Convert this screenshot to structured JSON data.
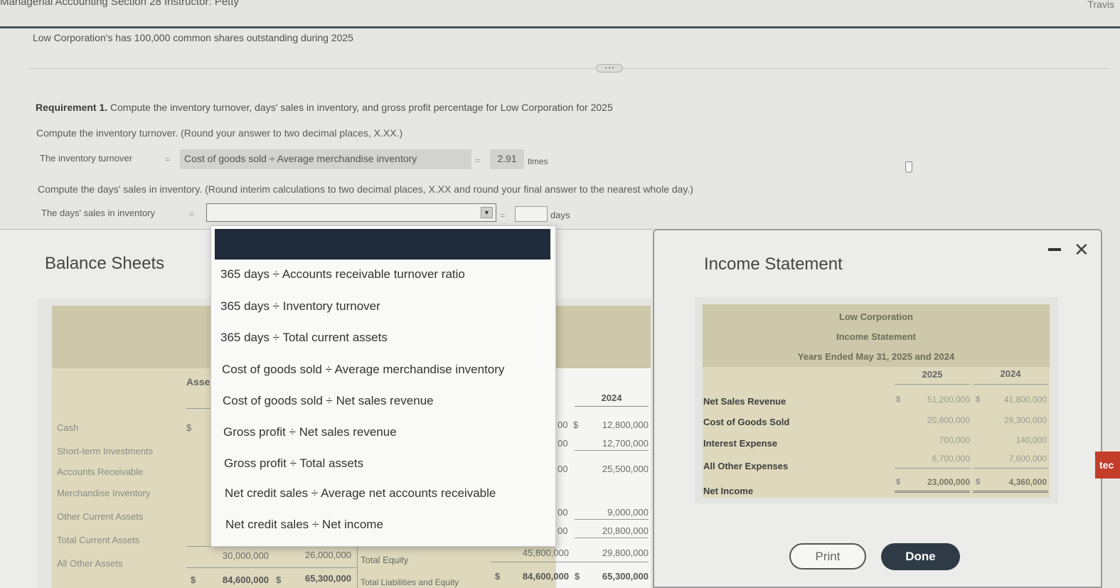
{
  "header": {
    "course": "Managerial Accounting Section 28 Instructor: Petty",
    "user": "Travis"
  },
  "intro": "Low Corporation's has 100,000 common shares outstanding during 2025",
  "requirement": {
    "label": "Requirement 1.",
    "text": "Compute the inventory turnover, days' sales in inventory, and gross profit percentage for Low Corporation for 2025"
  },
  "turnover": {
    "instruction": "Compute the inventory turnover. (Round your answer to two decimal places, X.XX.)",
    "label": "The inventory turnover",
    "eq1": "=",
    "formula": "Cost of goods sold ÷ Average merchandise inventory",
    "eq2": "=",
    "answer": "2.91",
    "unit": "times"
  },
  "days_sales": {
    "instruction": "Compute the days' sales in inventory. (Round interim calculations to two decimal places, X.XX and round your final answer to the nearest whole day.)",
    "label": "The days' sales in inventory",
    "eq1": "=",
    "selected_formula": "",
    "eq2": "=",
    "answer": "",
    "unit": "days"
  },
  "dropdown": {
    "options": [
      "365 days ÷ Accounts receivable turnover ratio",
      "365 days ÷ Inventory turnover",
      "365 days ÷ Total current assets",
      "Cost of goods sold ÷ Average merchandise inventory",
      "Cost of goods sold ÷ Net sales revenue",
      "Gross profit ÷ Net sales revenue",
      "Gross profit ÷ Total assets",
      "Net credit sales ÷ Average net accounts receivable",
      "Net credit sales ÷ Net income"
    ]
  },
  "balance_sheets": {
    "title": "Balance Sheets",
    "assets_header": "Asse",
    "col_2024": "2024",
    "rows": [
      {
        "label": "Cash",
        "cur": "$",
        "mid": "00",
        "cur2": "$",
        "v2024": "12,800,000"
      },
      {
        "label": "Short-term Investments",
        "mid": "00",
        "v2024": "12,700,000"
      },
      {
        "label": "Accounts Receivable",
        "mid": "00",
        "v2024": "25,500,000"
      },
      {
        "label": "Merchandise Inventory",
        "mid": "",
        "v2024": ""
      },
      {
        "label": "Other Current Assets",
        "mid": "00",
        "v2024": "9,000,000"
      },
      {
        "label": "Total Current Assets",
        "mid": "00",
        "v2024": "20,800,000"
      },
      {
        "label": "All Other Assets",
        "a2025": "30,000,000",
        "a2024": "26,000,000",
        "rlabel": "Total Equity",
        "r2025": "45,800,000",
        "r2024": "29,800,000"
      }
    ],
    "total_row": {
      "cur": "$",
      "a2025": "84,600,000",
      "cur2": "$",
      "a2024": "65,300,000",
      "rlabel": "Total Liabilities and Equity",
      "rcur": "$",
      "r2025": "84,600,000",
      "rcur2": "$",
      "r2024": "65,300,000"
    }
  },
  "income_statement": {
    "title": "Income Statement",
    "company": "Low Corporation",
    "statement": "Income Statement",
    "period": "Years Ended May 31, 2025 and 2024",
    "col_2025": "2025",
    "col_2024": "2024",
    "rows": [
      {
        "label": "Net Sales Revenue",
        "cur": "$",
        "v2025": "51,200,000",
        "cur2": "$",
        "v2024": "41,800,000"
      },
      {
        "label": "Cost of Goods Sold",
        "v2025": "20,800,000",
        "v2024": "29,300,000"
      },
      {
        "label": "Interest Expense",
        "v2025": "700,000",
        "v2024": "140,000"
      },
      {
        "label": "All Other Expenses",
        "v2025": "6,700,000",
        "v2024": "7,600,000"
      },
      {
        "label": "Net Income",
        "cur": "$",
        "v2025": "23,000,000",
        "cur2": "$",
        "v2024": "4,360,000"
      }
    ]
  },
  "buttons": {
    "print": "Print",
    "done": "Done"
  },
  "edge_tab": "tec"
}
